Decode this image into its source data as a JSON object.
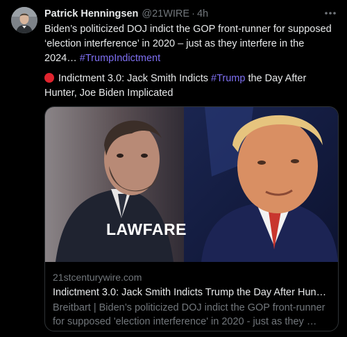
{
  "author": {
    "name": "Patrick Henningsen",
    "handle": "@21WIRE",
    "separator": "·",
    "time": "4h",
    "avatar_icon": "user-avatar"
  },
  "tweet": {
    "line1": "Biden’s politicized DOJ indict the GOP front-runner for supposed",
    "line2": "‘election interference’ in 2020 – just as they interfere in the",
    "line3_text": "2024… ",
    "line3_hashtag": "#TrumpIndictment",
    "headline_icon": "red-circle-icon",
    "headline_part1": "Indictment 3.0: Jack Smith Indicts ",
    "headline_hashtag": "#Trump",
    "headline_part2": " the Day After",
    "headline_line2": "Hunter, Joe Biden Implicated"
  },
  "card": {
    "image_caption": "LAWFARE",
    "domain": "21stcenturywire.com",
    "title": "Indictment 3.0: Jack Smith Indicts Trump the Day After Hun…",
    "desc_line1": "Breitbart | Biden’s politicized DOJ indict the GOP front-runner",
    "desc_line2": "for supposed 'election interference' in 2020 - just as they …"
  },
  "colors": {
    "background": "#000000",
    "text": "#e7e9ea",
    "muted": "#71767b",
    "hashtag": "#7e6ff2",
    "border": "#2f3336"
  }
}
